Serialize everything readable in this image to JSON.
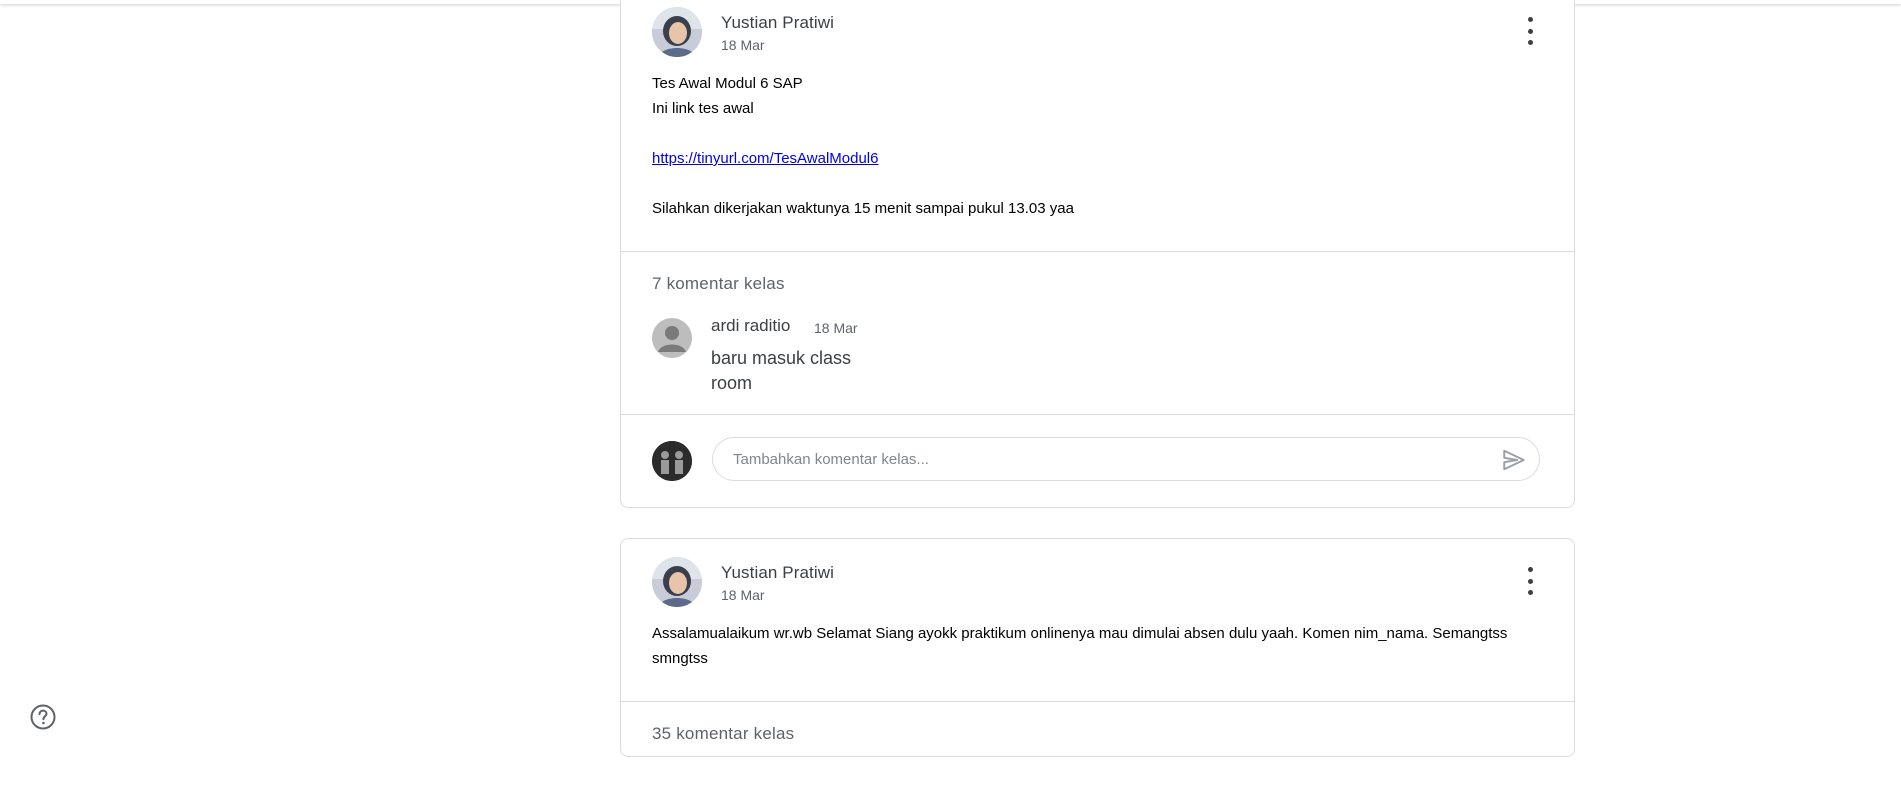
{
  "posts": [
    {
      "author": "Yustian Pratiwi",
      "date": "18 Mar",
      "lines": [
        "Tes Awal Modul 6 SAP",
        "Ini link tes awal"
      ],
      "link": "https://tinyurl.com/TesAwalModul6",
      "footer_line": "Silahkan dikerjakan waktunya 15 menit sampai pukul 13.03 yaa",
      "comments_count": "7 komentar kelas",
      "comment": {
        "name": "ardi raditio",
        "date": "18 Mar",
        "text": "baru masuk class room"
      },
      "add_comment_placeholder": "Tambahkan komentar kelas..."
    },
    {
      "author": "Yustian Pratiwi",
      "date": "18 Mar",
      "text": "Assalamualaikum wr.wb Selamat Siang ayokk praktikum onlinenya mau dimulai absen dulu yaah. Komen nim_nama. Semangtss smngtss",
      "comments_count": "35 komentar kelas"
    }
  ],
  "icons": {
    "more": "more-vert-icon",
    "send": "send-icon",
    "help": "help-icon",
    "user": "person-icon"
  },
  "colors": {
    "border": "#dadce0",
    "link": "#0000ee",
    "secondary_text": "#5f6368"
  }
}
